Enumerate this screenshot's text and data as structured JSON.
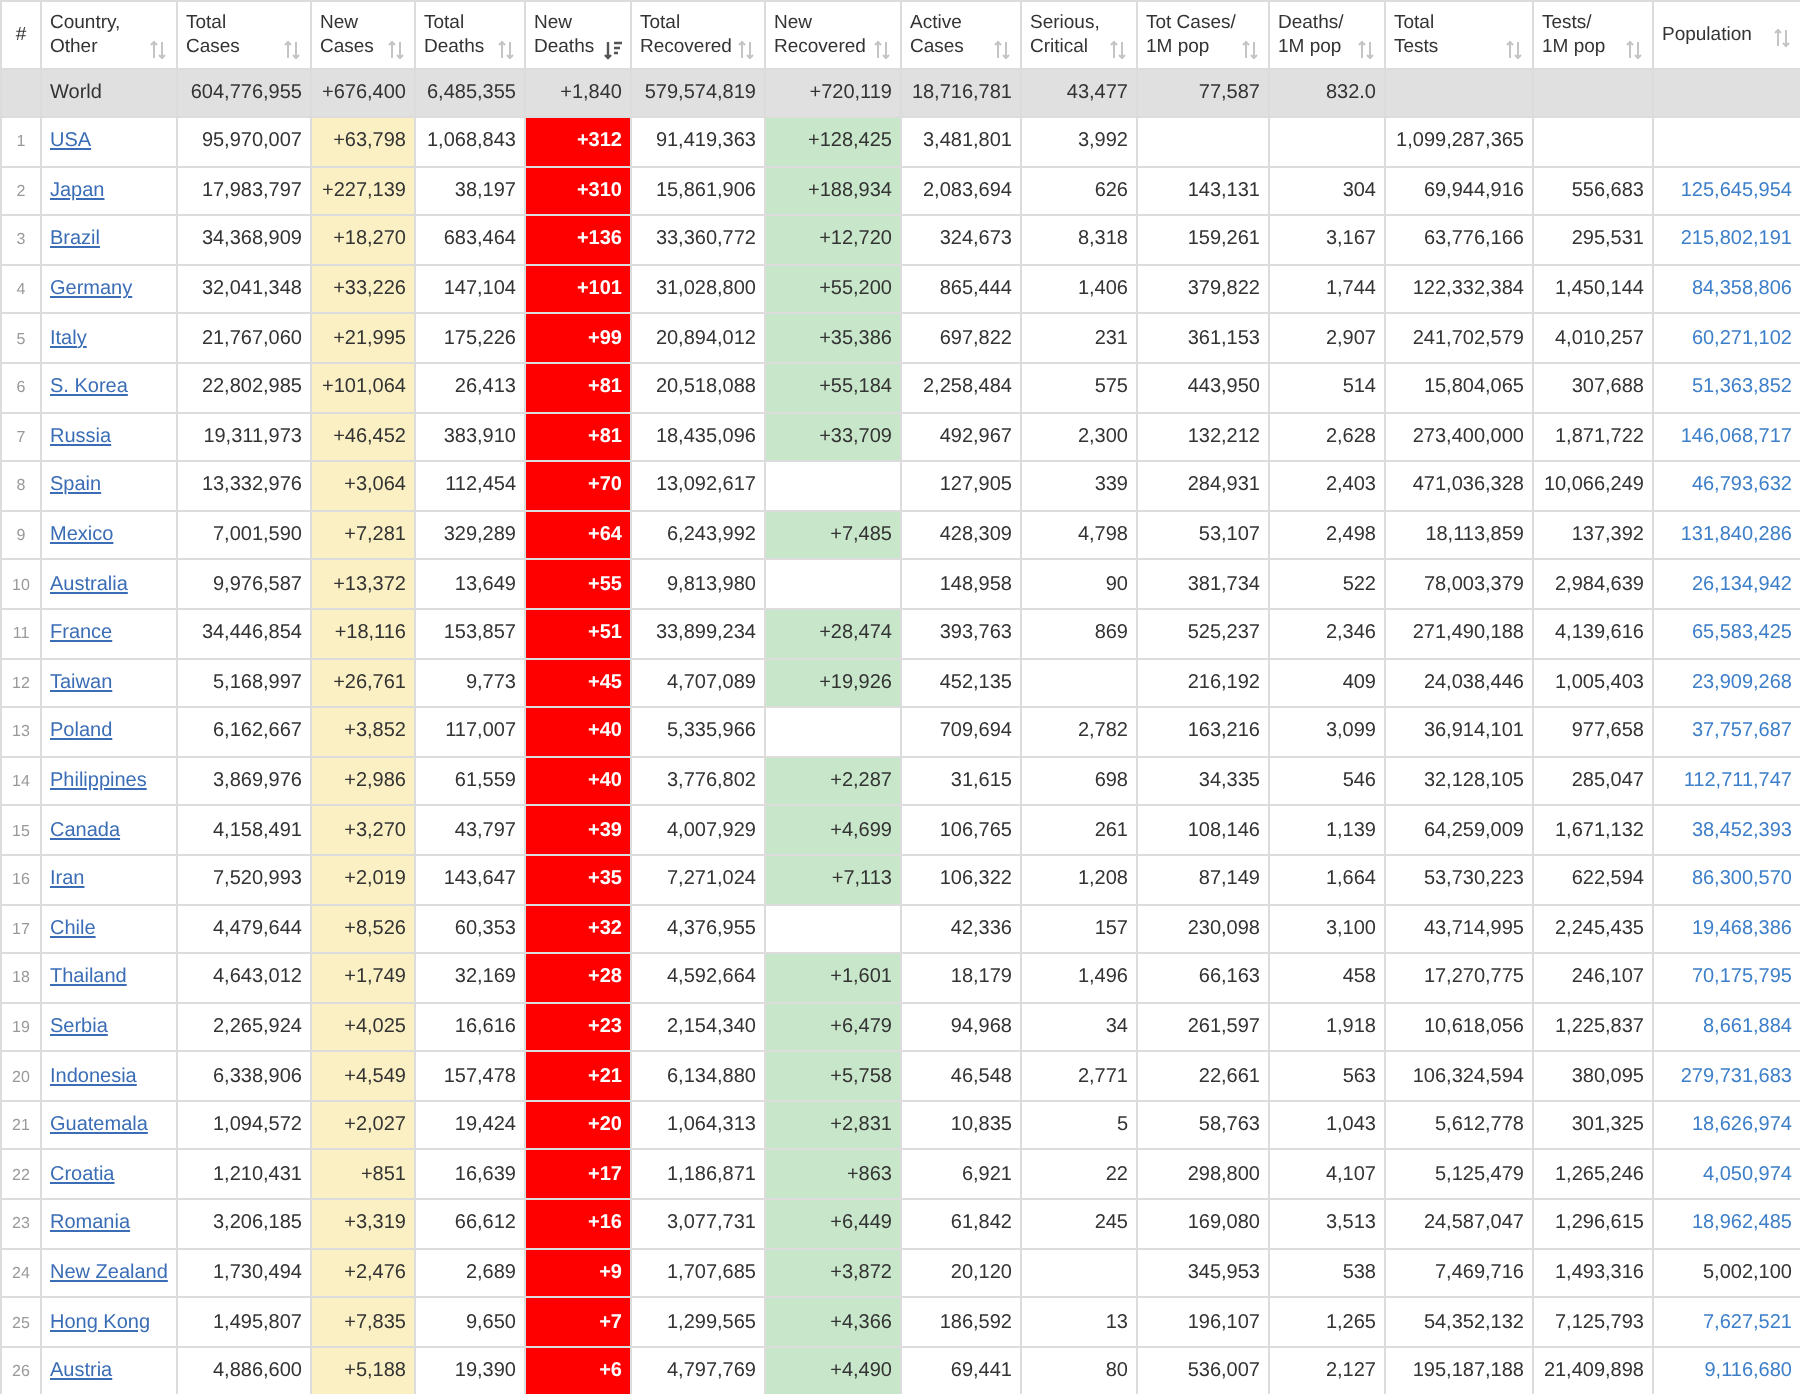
{
  "table": {
    "columns": [
      {
        "label_lines": [
          "#"
        ]
      },
      {
        "label_lines": [
          "Country,",
          "Other"
        ],
        "sorted": false
      },
      {
        "label_lines": [
          "Total",
          "Cases"
        ],
        "sorted": false
      },
      {
        "label_lines": [
          "New",
          "Cases"
        ],
        "sorted": false
      },
      {
        "label_lines": [
          "Total",
          "Deaths"
        ],
        "sorted": false
      },
      {
        "label_lines": [
          "New",
          "Deaths"
        ],
        "sorted": true
      },
      {
        "label_lines": [
          "Total",
          "Recovered"
        ],
        "sorted": false
      },
      {
        "label_lines": [
          "New",
          "Recovered"
        ],
        "sorted": false
      },
      {
        "label_lines": [
          "Active",
          "Cases"
        ],
        "sorted": false
      },
      {
        "label_lines": [
          "Serious,",
          "Critical"
        ],
        "sorted": false
      },
      {
        "label_lines": [
          "Tot Cases/",
          "1M pop"
        ],
        "sorted": false
      },
      {
        "label_lines": [
          "Deaths/",
          "1M pop"
        ],
        "sorted": false
      },
      {
        "label_lines": [
          "Total",
          "Tests"
        ],
        "sorted": false
      },
      {
        "label_lines": [
          "Tests/",
          "1M pop"
        ],
        "sorted": false
      },
      {
        "label_lines": [
          "Population"
        ],
        "sorted": false
      }
    ],
    "world": {
      "cells": [
        null,
        "World",
        "604,776,955",
        "+676,400",
        "6,485,355",
        "+1,840",
        "579,574,819",
        "+720,119",
        "18,716,781",
        "43,477",
        "77,587",
        "832.0",
        null,
        null,
        null
      ]
    },
    "rows": [
      {
        "cells": [
          "1",
          "USA",
          "95,970,007",
          "+63,798",
          "1,068,843",
          "+312",
          "91,419,363",
          "+128,425",
          "3,481,801",
          "3,992",
          null,
          null,
          "1,099,287,365",
          null,
          null
        ]
      },
      {
        "cells": [
          "2",
          "Japan",
          "17,983,797",
          "+227,139",
          "38,197",
          "+310",
          "15,861,906",
          "+188,934",
          "2,083,694",
          "626",
          "143,131",
          "304",
          "69,944,916",
          "556,683",
          "125,645,954"
        ],
        "population_link": true
      },
      {
        "cells": [
          "3",
          "Brazil",
          "34,368,909",
          "+18,270",
          "683,464",
          "+136",
          "33,360,772",
          "+12,720",
          "324,673",
          "8,318",
          "159,261",
          "3,167",
          "63,776,166",
          "295,531",
          "215,802,191"
        ],
        "population_link": true
      },
      {
        "cells": [
          "4",
          "Germany",
          "32,041,348",
          "+33,226",
          "147,104",
          "+101",
          "31,028,800",
          "+55,200",
          "865,444",
          "1,406",
          "379,822",
          "1,744",
          "122,332,384",
          "1,450,144",
          "84,358,806"
        ],
        "population_link": true
      },
      {
        "cells": [
          "5",
          "Italy",
          "21,767,060",
          "+21,995",
          "175,226",
          "+99",
          "20,894,012",
          "+35,386",
          "697,822",
          "231",
          "361,153",
          "2,907",
          "241,702,579",
          "4,010,257",
          "60,271,102"
        ],
        "population_link": true
      },
      {
        "cells": [
          "6",
          "S. Korea",
          "22,802,985",
          "+101,064",
          "26,413",
          "+81",
          "20,518,088",
          "+55,184",
          "2,258,484",
          "575",
          "443,950",
          "514",
          "15,804,065",
          "307,688",
          "51,363,852"
        ],
        "population_link": true
      },
      {
        "cells": [
          "7",
          "Russia",
          "19,311,973",
          "+46,452",
          "383,910",
          "+81",
          "18,435,096",
          "+33,709",
          "492,967",
          "2,300",
          "132,212",
          "2,628",
          "273,400,000",
          "1,871,722",
          "146,068,717"
        ],
        "population_link": true
      },
      {
        "cells": [
          "8",
          "Spain",
          "13,332,976",
          "+3,064",
          "112,454",
          "+70",
          "13,092,617",
          null,
          "127,905",
          "339",
          "284,931",
          "2,403",
          "471,036,328",
          "10,066,249",
          "46,793,632"
        ],
        "population_link": true
      },
      {
        "cells": [
          "9",
          "Mexico",
          "7,001,590",
          "+7,281",
          "329,289",
          "+64",
          "6,243,992",
          "+7,485",
          "428,309",
          "4,798",
          "53,107",
          "2,498",
          "18,113,859",
          "137,392",
          "131,840,286"
        ],
        "population_link": true
      },
      {
        "cells": [
          "10",
          "Australia",
          "9,976,587",
          "+13,372",
          "13,649",
          "+55",
          "9,813,980",
          null,
          "148,958",
          "90",
          "381,734",
          "522",
          "78,003,379",
          "2,984,639",
          "26,134,942"
        ],
        "population_link": true
      },
      {
        "cells": [
          "11",
          "France",
          "34,446,854",
          "+18,116",
          "153,857",
          "+51",
          "33,899,234",
          "+28,474",
          "393,763",
          "869",
          "525,237",
          "2,346",
          "271,490,188",
          "4,139,616",
          "65,583,425"
        ],
        "population_link": true
      },
      {
        "cells": [
          "12",
          "Taiwan",
          "5,168,997",
          "+26,761",
          "9,773",
          "+45",
          "4,707,089",
          "+19,926",
          "452,135",
          null,
          "216,192",
          "409",
          "24,038,446",
          "1,005,403",
          "23,909,268"
        ],
        "population_link": true
      },
      {
        "cells": [
          "13",
          "Poland",
          "6,162,667",
          "+3,852",
          "117,007",
          "+40",
          "5,335,966",
          null,
          "709,694",
          "2,782",
          "163,216",
          "3,099",
          "36,914,101",
          "977,658",
          "37,757,687"
        ],
        "population_link": true
      },
      {
        "cells": [
          "14",
          "Philippines",
          "3,869,976",
          "+2,986",
          "61,559",
          "+40",
          "3,776,802",
          "+2,287",
          "31,615",
          "698",
          "34,335",
          "546",
          "32,128,105",
          "285,047",
          "112,711,747"
        ],
        "population_link": true
      },
      {
        "cells": [
          "15",
          "Canada",
          "4,158,491",
          "+3,270",
          "43,797",
          "+39",
          "4,007,929",
          "+4,699",
          "106,765",
          "261",
          "108,146",
          "1,139",
          "64,259,009",
          "1,671,132",
          "38,452,393"
        ],
        "population_link": true
      },
      {
        "cells": [
          "16",
          "Iran",
          "7,520,993",
          "+2,019",
          "143,647",
          "+35",
          "7,271,024",
          "+7,113",
          "106,322",
          "1,208",
          "87,149",
          "1,664",
          "53,730,223",
          "622,594",
          "86,300,570"
        ],
        "population_link": true
      },
      {
        "cells": [
          "17",
          "Chile",
          "4,479,644",
          "+8,526",
          "60,353",
          "+32",
          "4,376,955",
          null,
          "42,336",
          "157",
          "230,098",
          "3,100",
          "43,714,995",
          "2,245,435",
          "19,468,386"
        ],
        "population_link": true
      },
      {
        "cells": [
          "18",
          "Thailand",
          "4,643,012",
          "+1,749",
          "32,169",
          "+28",
          "4,592,664",
          "+1,601",
          "18,179",
          "1,496",
          "66,163",
          "458",
          "17,270,775",
          "246,107",
          "70,175,795"
        ],
        "population_link": true
      },
      {
        "cells": [
          "19",
          "Serbia",
          "2,265,924",
          "+4,025",
          "16,616",
          "+23",
          "2,154,340",
          "+6,479",
          "94,968",
          "34",
          "261,597",
          "1,918",
          "10,618,056",
          "1,225,837",
          "8,661,884"
        ],
        "population_link": true
      },
      {
        "cells": [
          "20",
          "Indonesia",
          "6,338,906",
          "+4,549",
          "157,478",
          "+21",
          "6,134,880",
          "+5,758",
          "46,548",
          "2,771",
          "22,661",
          "563",
          "106,324,594",
          "380,095",
          "279,731,683"
        ],
        "population_link": true
      },
      {
        "cells": [
          "21",
          "Guatemala",
          "1,094,572",
          "+2,027",
          "19,424",
          "+20",
          "1,064,313",
          "+2,831",
          "10,835",
          "5",
          "58,763",
          "1,043",
          "5,612,778",
          "301,325",
          "18,626,974"
        ],
        "population_link": true
      },
      {
        "cells": [
          "22",
          "Croatia",
          "1,210,431",
          "+851",
          "16,639",
          "+17",
          "1,186,871",
          "+863",
          "6,921",
          "22",
          "298,800",
          "4,107",
          "5,125,479",
          "1,265,246",
          "4,050,974"
        ],
        "population_link": true
      },
      {
        "cells": [
          "23",
          "Romania",
          "3,206,185",
          "+3,319",
          "66,612",
          "+16",
          "3,077,731",
          "+6,449",
          "61,842",
          "245",
          "169,080",
          "3,513",
          "24,587,047",
          "1,296,615",
          "18,962,485"
        ],
        "population_link": true
      },
      {
        "cells": [
          "24",
          "New Zealand",
          "1,730,494",
          "+2,476",
          "2,689",
          "+9",
          "1,707,685",
          "+3,872",
          "20,120",
          null,
          "345,953",
          "538",
          "7,469,716",
          "1,493,316",
          "5,002,100"
        ],
        "population_link": false
      },
      {
        "cells": [
          "25",
          "Hong Kong",
          "1,495,807",
          "+7,835",
          "9,650",
          "+7",
          "1,299,565",
          "+4,366",
          "186,592",
          "13",
          "196,107",
          "1,265",
          "54,352,132",
          "7,125,793",
          "7,627,521"
        ],
        "population_link": true
      },
      {
        "cells": [
          "26",
          "Austria",
          "4,886,600",
          "+5,188",
          "19,390",
          "+6",
          "4,797,769",
          "+4,490",
          "69,441",
          "80",
          "536,007",
          "2,127",
          "195,187,188",
          "21,409,898",
          "9,116,680"
        ],
        "population_link": true
      }
    ]
  }
}
